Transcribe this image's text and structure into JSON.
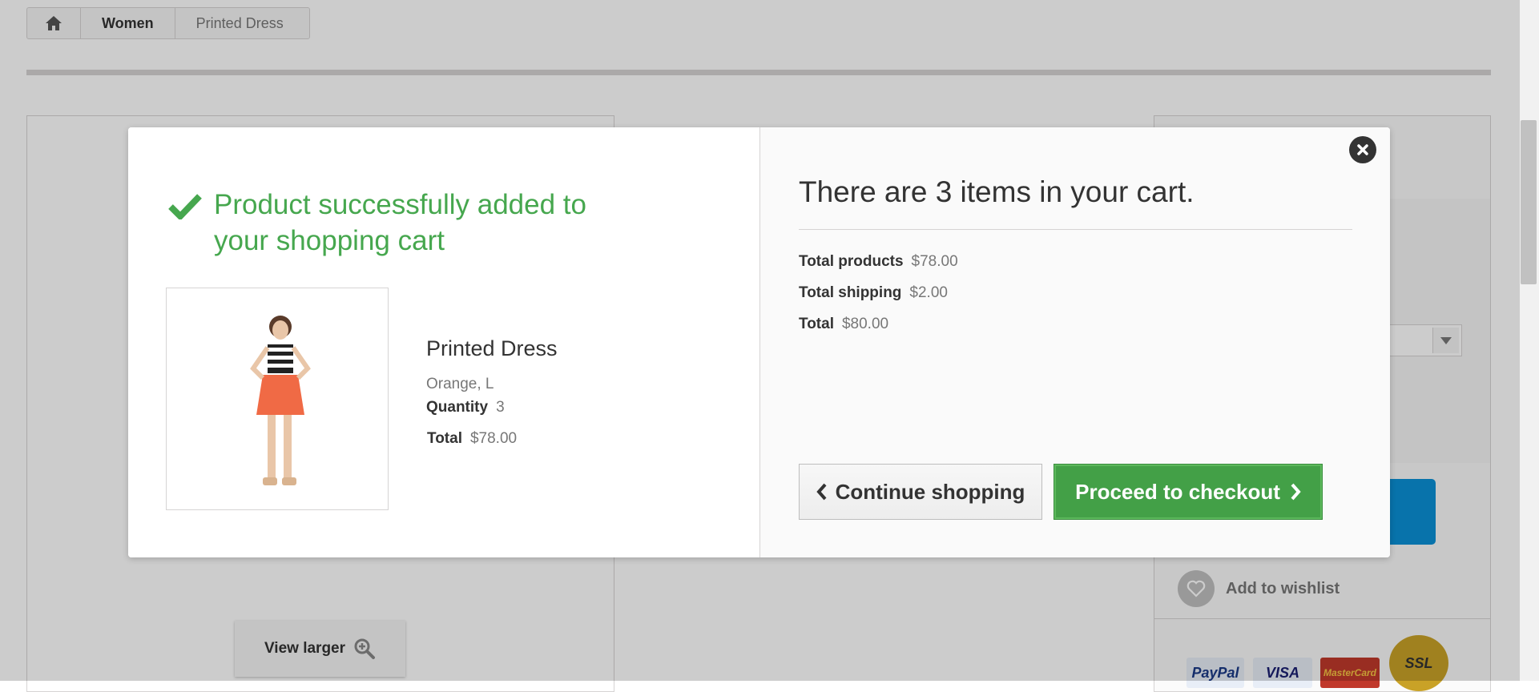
{
  "breadcrumb": {
    "home_icon": "home-icon",
    "items": [
      "Women",
      "Printed Dress"
    ]
  },
  "product_page": {
    "view_larger_label": "View larger",
    "wishlist_label": "Add to wishlist",
    "payment_logos": [
      "PayPal",
      "VISA",
      "MasterCard",
      "SSL"
    ]
  },
  "modal": {
    "success_message": "Product successfully added to your shopping cart",
    "product": {
      "name": "Printed Dress",
      "attributes": "Orange, L",
      "quantity_label": "Quantity",
      "quantity_value": "3",
      "total_label": "Total",
      "total_value": "$78.00"
    },
    "cart": {
      "count_message": "There are 3 items in your cart.",
      "summary": [
        {
          "label": "Total products",
          "value": "$78.00"
        },
        {
          "label": "Total shipping",
          "value": "$2.00"
        },
        {
          "label": "Total",
          "value": "$80.00"
        }
      ]
    },
    "buttons": {
      "continue_label": "Continue shopping",
      "checkout_label": "Proceed to checkout"
    }
  },
  "colors": {
    "success_green": "#46a74e",
    "checkout_green": "#43a047",
    "cart_blue": "#0a90d6"
  }
}
